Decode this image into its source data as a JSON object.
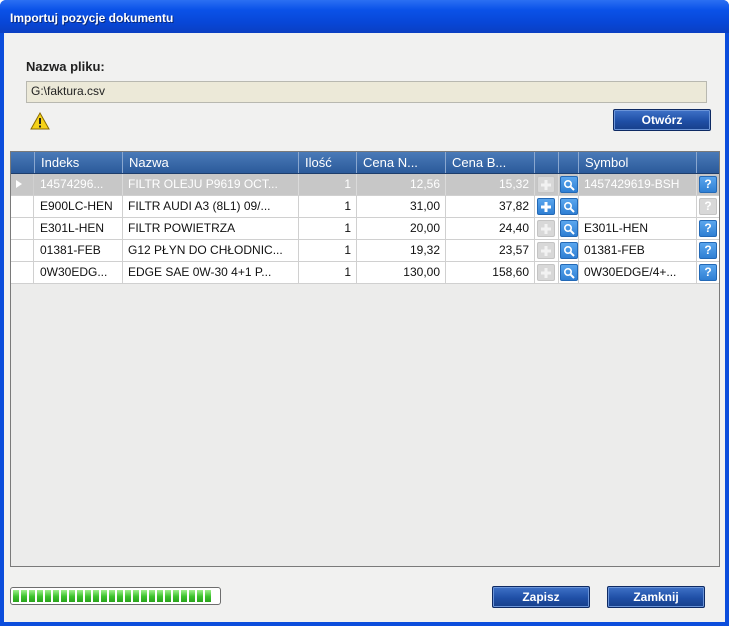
{
  "window": {
    "title": "Importuj pozycje dokumentu"
  },
  "file": {
    "label": "Nazwa pliku:",
    "value": "G:\\faktura.csv"
  },
  "buttons": {
    "open": "Otwórz",
    "save": "Zapisz",
    "close": "Zamknij"
  },
  "grid": {
    "columns": [
      "Indeks",
      "Nazwa",
      "Ilość",
      "Cena N...",
      "Cena B...",
      "",
      "",
      "Symbol",
      ""
    ],
    "rows": [
      {
        "indeks": "14574296...",
        "nazwa": "FILTR OLEJU P9619 OCT...",
        "ilosc": "1",
        "cena_n": "12,56",
        "cena_b": "15,32",
        "add_state": "disabled",
        "symbol": "1457429619-BSH",
        "help_state": "active",
        "selected": true
      },
      {
        "indeks": "E900LC-HEN",
        "nazwa": "FILTR AUDI A3 (8L1) 09/...",
        "ilosc": "1",
        "cena_n": "31,00",
        "cena_b": "37,82",
        "add_state": "active",
        "symbol": "",
        "help_state": "disabled",
        "selected": false
      },
      {
        "indeks": "E301L-HEN",
        "nazwa": "FILTR POWIETRZA",
        "ilosc": "1",
        "cena_n": "20,00",
        "cena_b": "24,40",
        "add_state": "disabled",
        "symbol": "E301L-HEN",
        "help_state": "active",
        "selected": false
      },
      {
        "indeks": "01381-FEB",
        "nazwa": "G12 PŁYN DO CHŁODNIC...",
        "ilosc": "1",
        "cena_n": "19,32",
        "cena_b": "23,57",
        "add_state": "disabled",
        "symbol": "01381-FEB",
        "help_state": "active",
        "selected": false
      },
      {
        "indeks": "0W30EDG...",
        "nazwa": "EDGE SAE 0W-30 4+1 P...",
        "ilosc": "1",
        "cena_n": "130,00",
        "cena_b": "158,60",
        "add_state": "disabled",
        "symbol": "0W30EDGE/4+...",
        "help_state": "active",
        "selected": false
      }
    ]
  },
  "progress": {
    "fraction": 1.0
  },
  "icons": {
    "warning": "warning-icon",
    "add": "add-icon",
    "search": "search-icon",
    "help": "help-icon",
    "row_pointer": "row-pointer-icon"
  },
  "colors": {
    "title_bar": "#0a52e8",
    "header": "#2b5a9a",
    "progress": "#3cc22c"
  }
}
